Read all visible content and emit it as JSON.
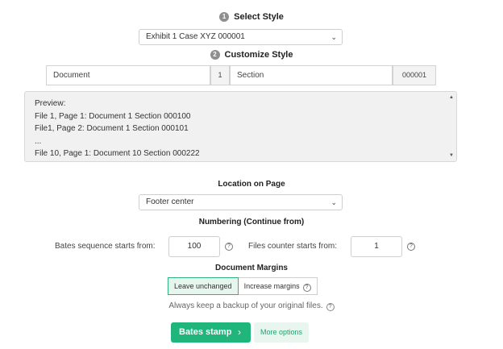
{
  "step1": {
    "number": "1",
    "title": "Select Style"
  },
  "style_select": {
    "value": "Exhibit 1 Case XYZ 000001"
  },
  "step2": {
    "number": "2",
    "title": "Customize Style"
  },
  "customize": {
    "prefix": "Document",
    "prefix_num": "1",
    "suffix": "Section",
    "suffix_num": "000001"
  },
  "preview": {
    "label": "Preview:",
    "lines": [
      "File 1, Page 1: Document 1 Section 000100",
      "File1, Page 2: Document 1 Section 000101",
      "...",
      "File 10, Page 1: Document 10 Section 000222"
    ]
  },
  "location": {
    "title": "Location on Page",
    "value": "Footer center"
  },
  "numbering": {
    "title": "Numbering (Continue from)",
    "bates_label": "Bates sequence starts from:",
    "bates_value": "100",
    "files_label": "Files counter starts from:",
    "files_value": "1"
  },
  "margins": {
    "title": "Document Margins",
    "options": [
      "Leave unchanged",
      "Increase margins"
    ],
    "selected": "Leave unchanged"
  },
  "note": "Always keep a backup of your original files.",
  "actions": {
    "primary": "Bates stamp",
    "secondary": "More options"
  },
  "colors": {
    "accent": "#20b57a",
    "accent_light": "#e8f6ef"
  }
}
